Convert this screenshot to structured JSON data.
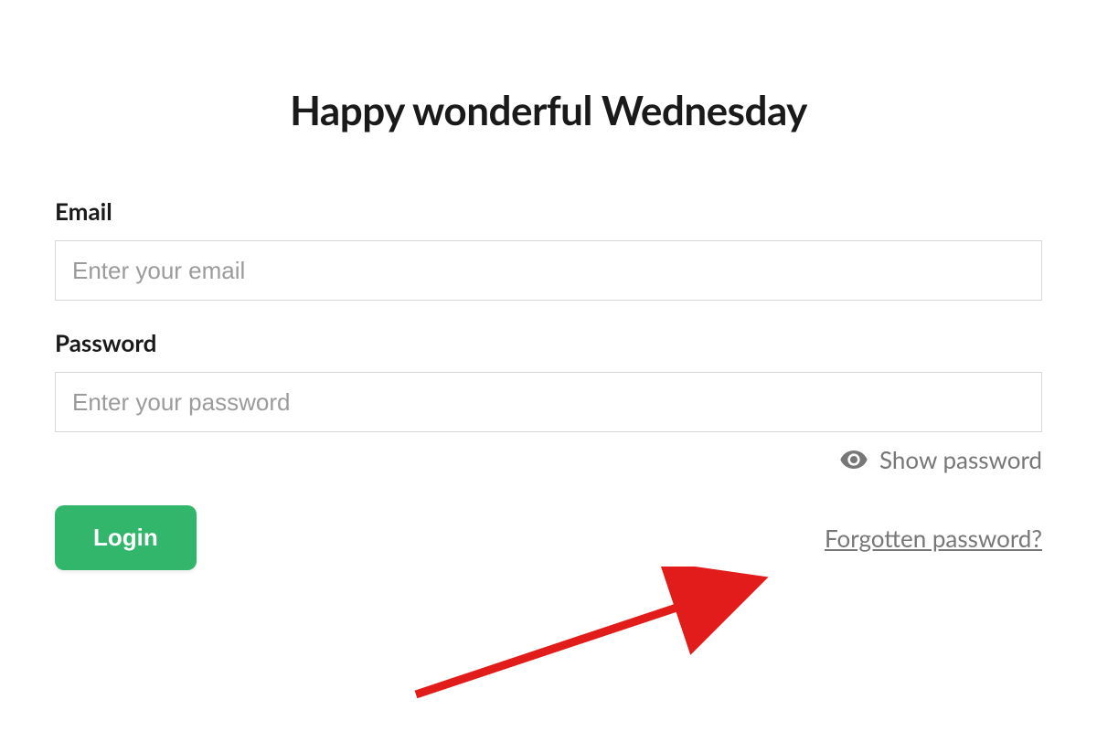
{
  "title": "Happy wonderful Wednesday",
  "email": {
    "label": "Email",
    "placeholder": "Enter your email",
    "value": ""
  },
  "password": {
    "label": "Password",
    "placeholder": "Enter your password",
    "value": ""
  },
  "show_password_label": "Show password",
  "login_button_label": "Login",
  "forgot_password_label": "Forgotten password?",
  "colors": {
    "accent_green": "#32b66b",
    "text_dark": "#1a1a1a",
    "text_muted": "#777777",
    "border": "#d8d8d8",
    "annotation_red": "#e21b1b"
  }
}
